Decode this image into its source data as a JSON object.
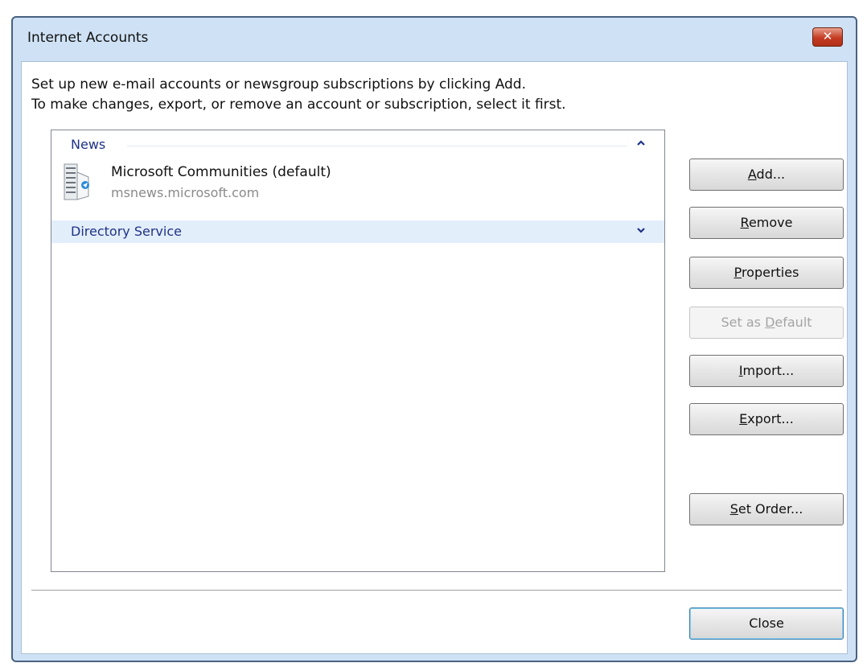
{
  "window": {
    "title": "Internet Accounts"
  },
  "instructions": {
    "line1": "Set up new e-mail accounts or newsgroup subscriptions by clicking Add.",
    "line2": "To make changes, export, or remove an account or subscription, select it first."
  },
  "account_list": {
    "groups": [
      {
        "label": "News",
        "expanded": true,
        "accounts": [
          {
            "name": "Microsoft Communities (default)",
            "server": "msnews.microsoft.com",
            "icon": "news-server-icon"
          }
        ]
      },
      {
        "label": "Directory Service",
        "expanded": false,
        "selected": true
      }
    ]
  },
  "buttons": {
    "add": {
      "pre": "",
      "accel": "A",
      "post": "dd..."
    },
    "remove": {
      "pre": "",
      "accel": "R",
      "post": "emove"
    },
    "properties": {
      "pre": "",
      "accel": "P",
      "post": "roperties"
    },
    "set_default": {
      "pre": "Set as ",
      "accel": "D",
      "post": "efault",
      "enabled": false
    },
    "import": {
      "pre": "",
      "accel": "I",
      "post": "mport..."
    },
    "export": {
      "pre": "",
      "accel": "E",
      "post": "xport..."
    },
    "set_order": {
      "pre": "",
      "accel": "S",
      "post": "et Order..."
    },
    "close": {
      "label": "Close"
    }
  },
  "colors": {
    "window_frame": "#cfe2f5",
    "group_header_text": "#1e3287",
    "selection_background": "#e3eefb",
    "close_button": "#c43b22"
  }
}
